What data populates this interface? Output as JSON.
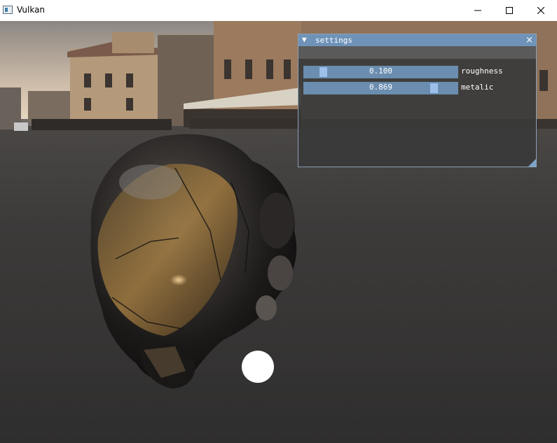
{
  "window": {
    "title": "Vulkan",
    "icon": "vulkan-app-icon",
    "controls": [
      "minimize-icon",
      "maximize-icon",
      "close-icon"
    ]
  },
  "viewport": {
    "scene": "damaged-helmet-pbr-render",
    "environment": "town-square-at-dusk",
    "light_marker": "light-source-icon"
  },
  "settings": {
    "title": "settings",
    "collapse_glyph": "▼",
    "close_glyph": "×",
    "sliders": [
      {
        "label": "roughness",
        "display": "0.100",
        "value": 0.1,
        "min": 0,
        "max": 1
      },
      {
        "label": "metalic",
        "display": "0.869",
        "value": 0.869,
        "min": 0,
        "max": 1
      }
    ],
    "colors": {
      "title_bg": "#6f93b8",
      "frame": "#6a8db0",
      "grab": "#9cc0ea",
      "panel": "#3a3a3a"
    }
  }
}
